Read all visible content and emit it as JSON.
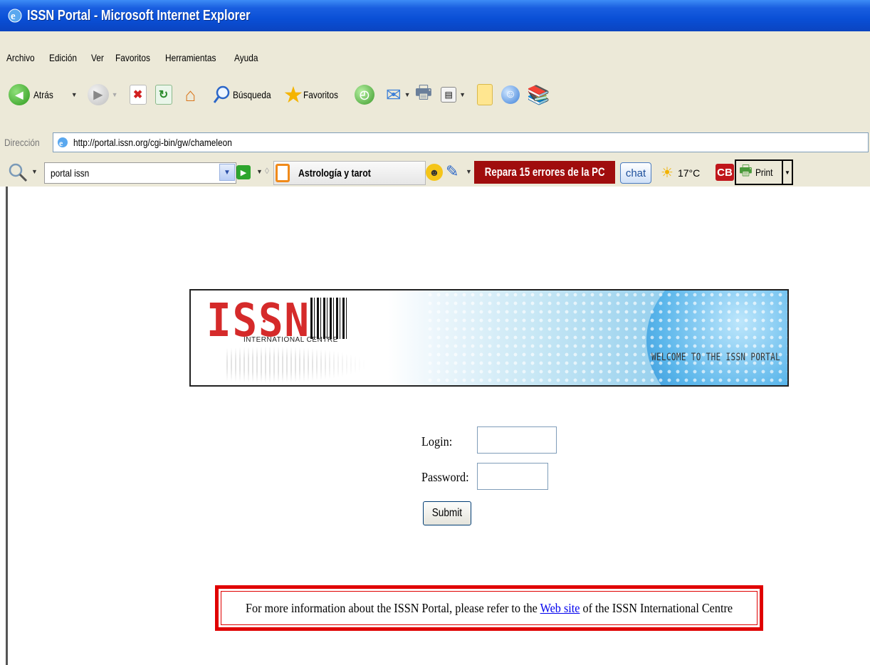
{
  "window": {
    "title": "ISSN Portal - Microsoft Internet Explorer"
  },
  "menu": {
    "items": [
      "Archivo",
      "Edición",
      "Ver",
      "Favoritos",
      "Herramientas",
      "Ayuda"
    ]
  },
  "toolbar": {
    "back_label": "Atrás",
    "search_label": "Búsqueda",
    "favorites_label": "Favoritos"
  },
  "address": {
    "label": "Dirección",
    "url": "http://portal.issn.org/cgi-bin/gw/chameleon"
  },
  "search_toolbar": {
    "query": "portal issn",
    "astro_label": "Astrología y tarot",
    "repair_label": "Repara 15 errores de la PC",
    "chat_label": "chat",
    "temperature": "17°C",
    "cb_label": "CB",
    "print_label": "Print"
  },
  "banner": {
    "logo_text": "ISSN",
    "logo_subtitle": "INTERNATIONAL CENTRE",
    "welcome": "WELCOME TO THE ISSN PORTAL"
  },
  "form": {
    "login_label": "Login:",
    "password_label": "Password:",
    "login_value": "",
    "password_value": "",
    "submit_label": "Submit"
  },
  "info": {
    "before": "For more information about the ISSN Portal, please refer to the ",
    "link": "Web site",
    "after": " of the ISSN International Centre"
  },
  "colors": {
    "titlebar": "#0a4fd6",
    "repair_banner": "#a00d0d",
    "info_border": "#e00000",
    "logo_red": "#d52a2a"
  }
}
